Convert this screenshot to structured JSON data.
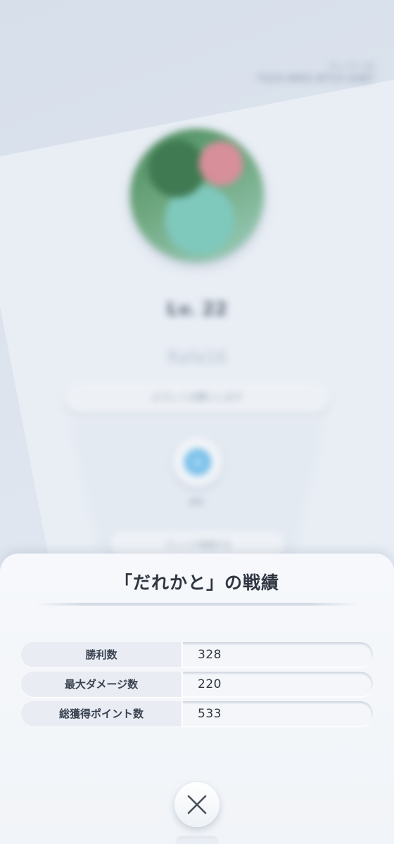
{
  "background_profile": {
    "player_id_label": "プレイヤーID",
    "player_id": "7123-4451-6713-3287",
    "level": "Lv. 22",
    "player_name": "Rafa16",
    "message": "よろしくお願いします",
    "emblem_label": "称号",
    "friend_button_label": "フレンド申請する"
  },
  "modal": {
    "title": "「だれかと」の戦績",
    "stats": [
      {
        "label": "勝利数",
        "value": "328"
      },
      {
        "label": "最大ダメージ数",
        "value": "220"
      },
      {
        "label": "総獲得ポイント数",
        "value": "533"
      }
    ],
    "close_icon": "close-icon"
  },
  "colors": {
    "sheet_background": "#f6f8fb",
    "title_text": "#2f3640",
    "label_cell": "#e9edf3"
  }
}
